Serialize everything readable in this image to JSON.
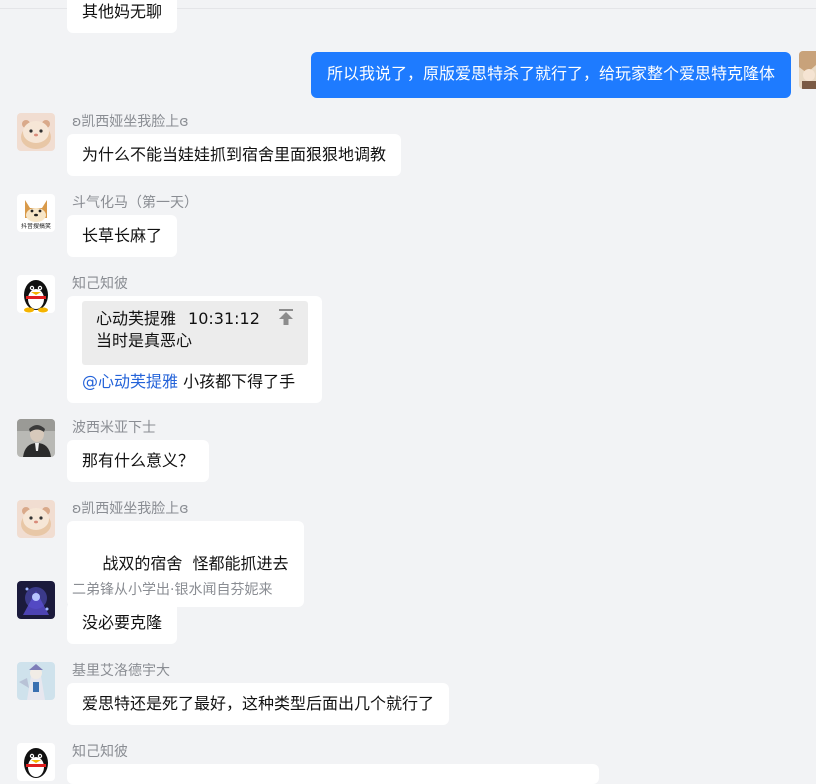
{
  "chat": {
    "messages": [
      {
        "sender": "",
        "text": "其他妈无聊",
        "direction": "in",
        "avatar_icon": "none"
      },
      {
        "sender": "",
        "text": "所以我说了，原版爱思特杀了就行了，给玩家整个爱思特克隆体",
        "direction": "out",
        "avatar_icon": "anime-avatar-icon"
      },
      {
        "sender": "ʚ凯西娅坐我脸上ɞ",
        "text": "为什么不能当娃娃抓到宿舍里面狠狠地调教",
        "direction": "in",
        "avatar_icon": "hamster-avatar-icon"
      },
      {
        "sender": "斗气化马（第一天）",
        "text": "长草长麻了",
        "direction": "in",
        "avatar_icon": "shiba-dog-avatar-icon",
        "avatar_caption": "抖音搜搞笑"
      },
      {
        "sender": "知己知彼",
        "direction": "in",
        "avatar_icon": "qq-penguin-avatar-icon",
        "quote": {
          "author": "心动芙提雅",
          "time": "10:31:12",
          "text": "当时是真恶心",
          "jump_icon": "jump-to-original-icon"
        },
        "mention": "@心动芙提雅",
        "text": "小孩都下得了手"
      },
      {
        "sender": "波西米亚下士",
        "text": "那有什么意义？",
        "direction": "in",
        "avatar_icon": "portrait-photo-avatar-icon"
      },
      {
        "sender": "ʚ凯西娅坐我脸上ɞ",
        "text": "战双的宿舍  怪都能抓进去",
        "direction": "in",
        "avatar_icon": "hamster-avatar-icon"
      },
      {
        "sender": "二弟锋从小学出·银水闻自芬妮来",
        "text": "没必要克隆",
        "direction": "in",
        "avatar_icon": "dark-purple-character-avatar-icon"
      },
      {
        "sender": "基里艾洛德宇大",
        "text": "爱思特还是死了最好，这种类型后面出几个就行了",
        "direction": "in",
        "avatar_icon": "mecha-character-avatar-icon"
      },
      {
        "sender": "知己知彼",
        "text": "",
        "direction": "in",
        "avatar_icon": "qq-penguin-avatar-icon"
      }
    ]
  },
  "colors": {
    "background": "#f2f3f5",
    "incoming_bubble": "#ffffff",
    "outgoing_bubble": "#1e7bff",
    "mention": "#2463d9",
    "sender_name": "#8a8d93"
  }
}
